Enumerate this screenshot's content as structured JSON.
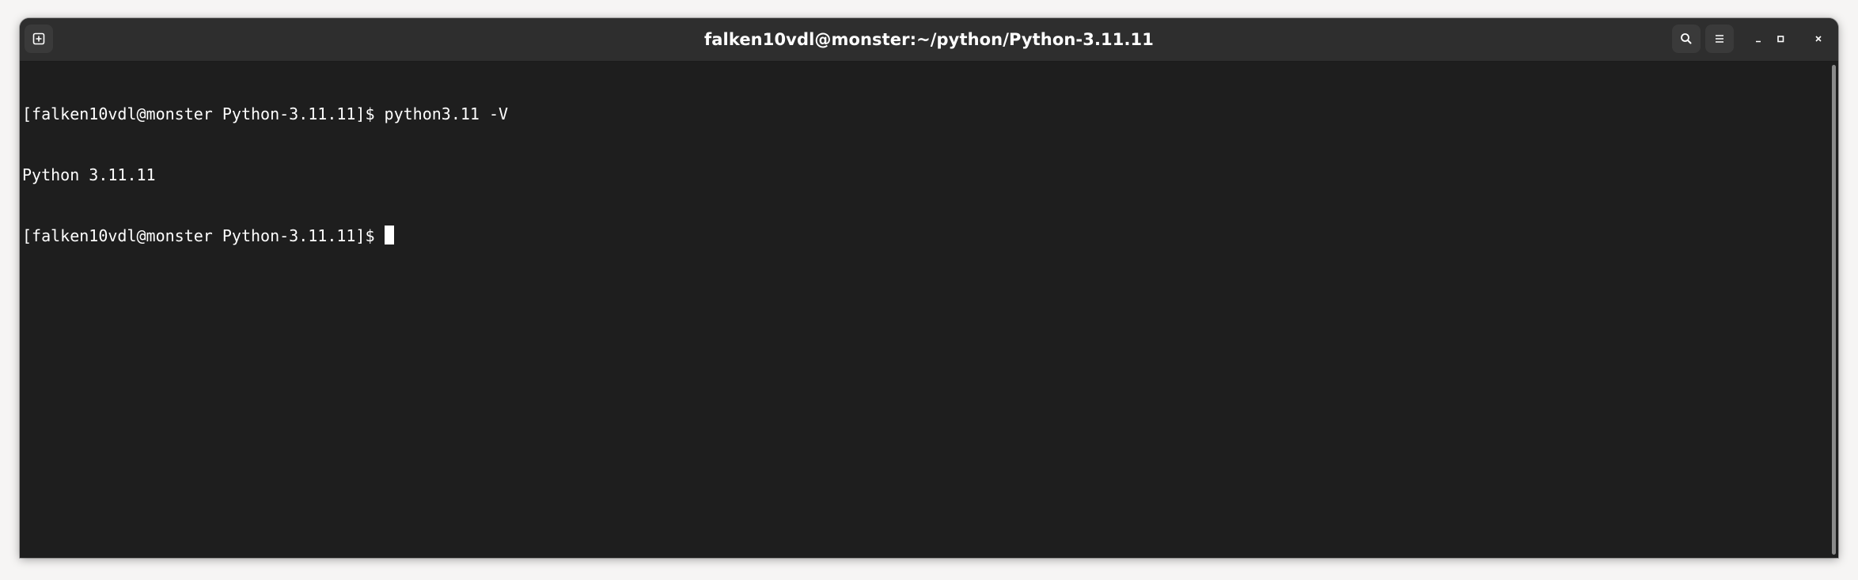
{
  "window": {
    "title": "falken10vdl@monster:~/python/Python-3.11.11"
  },
  "titlebar": {
    "icons": {
      "new_tab": "new-tab-icon",
      "search": "search-icon",
      "menu": "hamburger-menu-icon",
      "minimize": "minimize-icon",
      "maximize": "maximize-icon",
      "close": "close-icon"
    }
  },
  "terminal": {
    "lines": [
      "[falken10vdl@monster Python-3.11.11]$ python3.11 -V",
      "Python 3.11.11",
      "[falken10vdl@monster Python-3.11.11]$ "
    ]
  },
  "colors": {
    "terminal_bg": "#1e1e1e",
    "titlebar_bg": "#2e2e2e",
    "text": "#ffffff"
  }
}
